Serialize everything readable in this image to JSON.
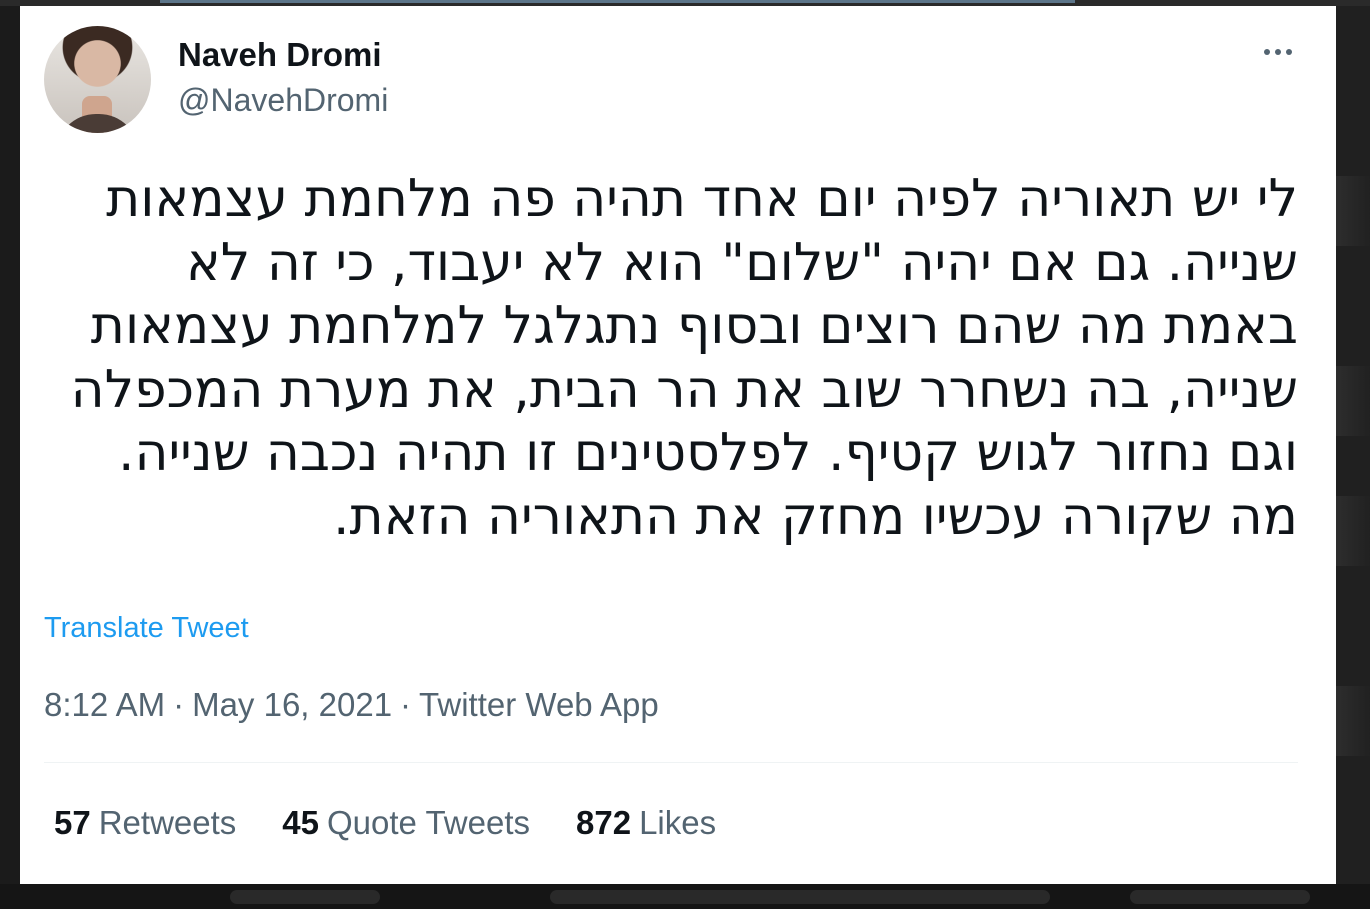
{
  "tweet": {
    "author": {
      "display_name": "Naveh Dromi",
      "handle": "@NavehDromi"
    },
    "text": "לי יש תאוריה לפיה יום אחד תהיה פה מלחמת עצמאות שנייה. גם אם יהיה \"שלום\" הוא לא יעבוד, כי זה לא באמת מה שהם רוצים ובסוף נתגלגל למלחמת עצמאות שנייה, בה נשחרר שוב את הר הבית, את מערת המכפלה וגם נחזור לגוש קטיף. לפלסטינים זו תהיה נכבה שנייה. מה שקורה עכשיו מחזק את התאוריה הזאת.",
    "translate_label": "Translate Tweet",
    "time": "8:12 AM",
    "date": "May 16, 2021",
    "source": "Twitter Web App",
    "separator": "·",
    "stats": {
      "retweets": {
        "count": "57",
        "label": "Retweets"
      },
      "quote_tweets": {
        "count": "45",
        "label": "Quote Tweets"
      },
      "likes": {
        "count": "872",
        "label": "Likes"
      }
    }
  },
  "icons": {
    "more": "more-horizontal-icon",
    "avatar": "profile-avatar"
  },
  "colors": {
    "link": "#1d9bf0",
    "secondary_text": "#536471",
    "primary_text": "#0f1419",
    "background": "#ffffff"
  }
}
